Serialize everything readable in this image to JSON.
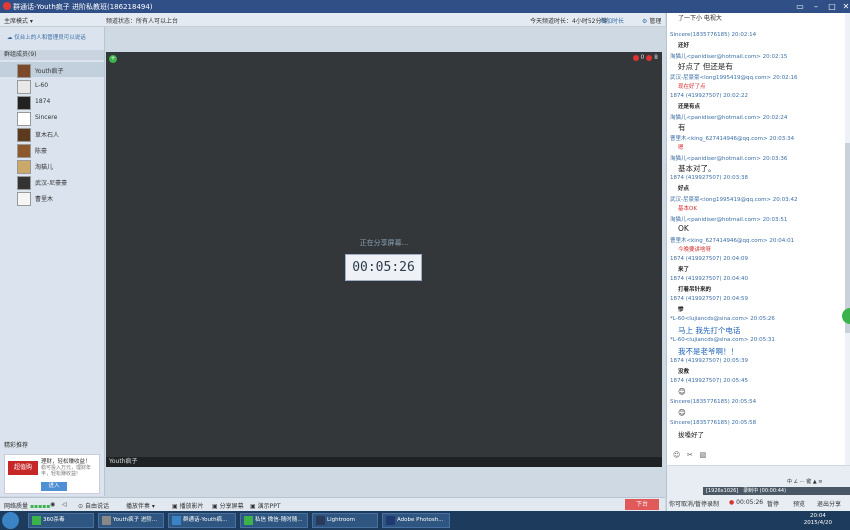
{
  "window": {
    "title": "群通话-Youth疯子 进阶私教班(186218494)"
  },
  "toprow": {
    "mode": "主席模式 ▾",
    "status": "频道状态：所有人可以上台",
    "duration": "今天频道时长：4小时52分钟",
    "vote": "增加时长",
    "manage": "管理"
  },
  "left": {
    "banner": "仅台上的人和管理员可以说话",
    "members_header": "群组成员(9)",
    "members": [
      {
        "name": "Youth疯子",
        "color": "#7a4a2a"
      },
      {
        "name": "L-60",
        "color": "#e8e8e8"
      },
      {
        "name": "1874",
        "color": "#222222"
      },
      {
        "name": "Sincere",
        "color": "#ffffff"
      },
      {
        "name": "草木石人",
        "color": "#5b3a1e"
      },
      {
        "name": "陈豪",
        "color": "#8c5a2a"
      },
      {
        "name": "淘猫儿",
        "color": "#c9a86a"
      },
      {
        "name": "武汉-尼豪豪",
        "color": "#333333"
      },
      {
        "name": "曹里木",
        "color": "#f5f5f5"
      }
    ],
    "recommend_header": "精彩推荐",
    "ad": {
      "logo": "超值购",
      "line1": "理财，轻松赚收益！",
      "line2": "稳可投入万元，理财年丰，轻松赚收益!",
      "button": "进入"
    }
  },
  "video": {
    "sharing": "正在分享屏幕...",
    "timer": "00:05:26",
    "presenter": "Youth疯子",
    "count_a": "0",
    "count_b": "8"
  },
  "bottombar": {
    "net": "网络质量",
    "mode": "自由说话",
    "playback": "播放伴奏 ▾",
    "movie": "播放影片",
    "share": "分享屏幕",
    "ppt": "演示PPT",
    "stop": "下台"
  },
  "chat": {
    "messages": [
      {
        "hdr": "Sincere(1835776185)  20:02:14",
        "text": "还好",
        "style": "bold"
      },
      {
        "hdr": "淘猫儿<panidiser@hotmail.com>  20:02:15",
        "text": "好点了  但还是有",
        "style": "big"
      },
      {
        "hdr": "武汉-尼豪豪<long1995419@qq.com>  20:02:16",
        "text": "现在好了点",
        "style": "red"
      },
      {
        "hdr": "1874  (419927507)  20:02:22",
        "text": "还是有点",
        "style": "bold"
      },
      {
        "hdr": "淘猫儿<panidiser@hotmail.com>  20:02:24",
        "text": "有",
        "style": "big"
      },
      {
        "hdr": "曹里木<king_627414946@qq.com>  20:03:34",
        "text": "嗯",
        "style": "red"
      },
      {
        "hdr": "淘猫儿<panidiser@hotmail.com>  20:03:36",
        "text": "基本对了。",
        "style": "big"
      },
      {
        "hdr": "1874  (419927507)  20:03:38",
        "text": "好点",
        "style": "bold"
      },
      {
        "hdr": "武汉-尼豪豪<long1995419@qq.com>  20:03:42",
        "text": "基本OK",
        "style": "red"
      },
      {
        "hdr": "淘猫儿<panidiser@hotmail.com>  20:03:51",
        "text": "OK",
        "style": "big"
      },
      {
        "hdr": "曹里木<king_627414946@qq.com>  20:04:01",
        "text": "今晚要讲啥呀",
        "style": "red"
      },
      {
        "hdr": "1874  (419927507)  20:04:09",
        "text": "来了",
        "style": "bold"
      },
      {
        "hdr": "1874  (419927507)  20:04:40",
        "text": "打着吊针来的",
        "style": "bold"
      },
      {
        "hdr": "1874  (419927507)  20:04:59",
        "text": "惨",
        "style": "bold"
      },
      {
        "hdr": "*L-60<lujiancds@sina.com>  20:05:26",
        "text": "马上  我先打个电话",
        "style": "blue"
      },
      {
        "hdr": "*L-60<lujiancds@sina.com>  20:05:31",
        "text": "我不是老爷啊！！",
        "style": "blue"
      },
      {
        "hdr": "1874  (419927507)  20:05:39",
        "text": "没救",
        "style": "bold"
      },
      {
        "hdr": "1874  (419927507)  20:05:45",
        "text": "😊",
        "style": "big"
      },
      {
        "hdr": "Sincere(1835776185)  20:05:54",
        "text": "😊",
        "style": "big"
      },
      {
        "hdr": "Sincere(1835776185)  20:05:58",
        "text": "拔嗓好了",
        "style": ""
      }
    ],
    "top_partial": "了一下小  电视大"
  },
  "rightbottom": {
    "toolbar_top": "中 ∠ ⋯ 键 ▲ ≡",
    "toolbar_mid": "[1926x1026]",
    "recording": "录制中 (00:00:44)",
    "row_label": "你可取消/暂停录制",
    "rec_time": "00:05:26",
    "btn1": "暂停",
    "btn2": "预览",
    "btn3": "退出分享"
  },
  "taskbar": {
    "items": [
      "360杀毒",
      "Youth疯子 进阶...",
      "群通话-Youth疯...",
      "私信 微信-随时随...",
      "Lightroom",
      "Adobe Photosh..."
    ],
    "time": "20:04",
    "date": "2015/4/20"
  }
}
